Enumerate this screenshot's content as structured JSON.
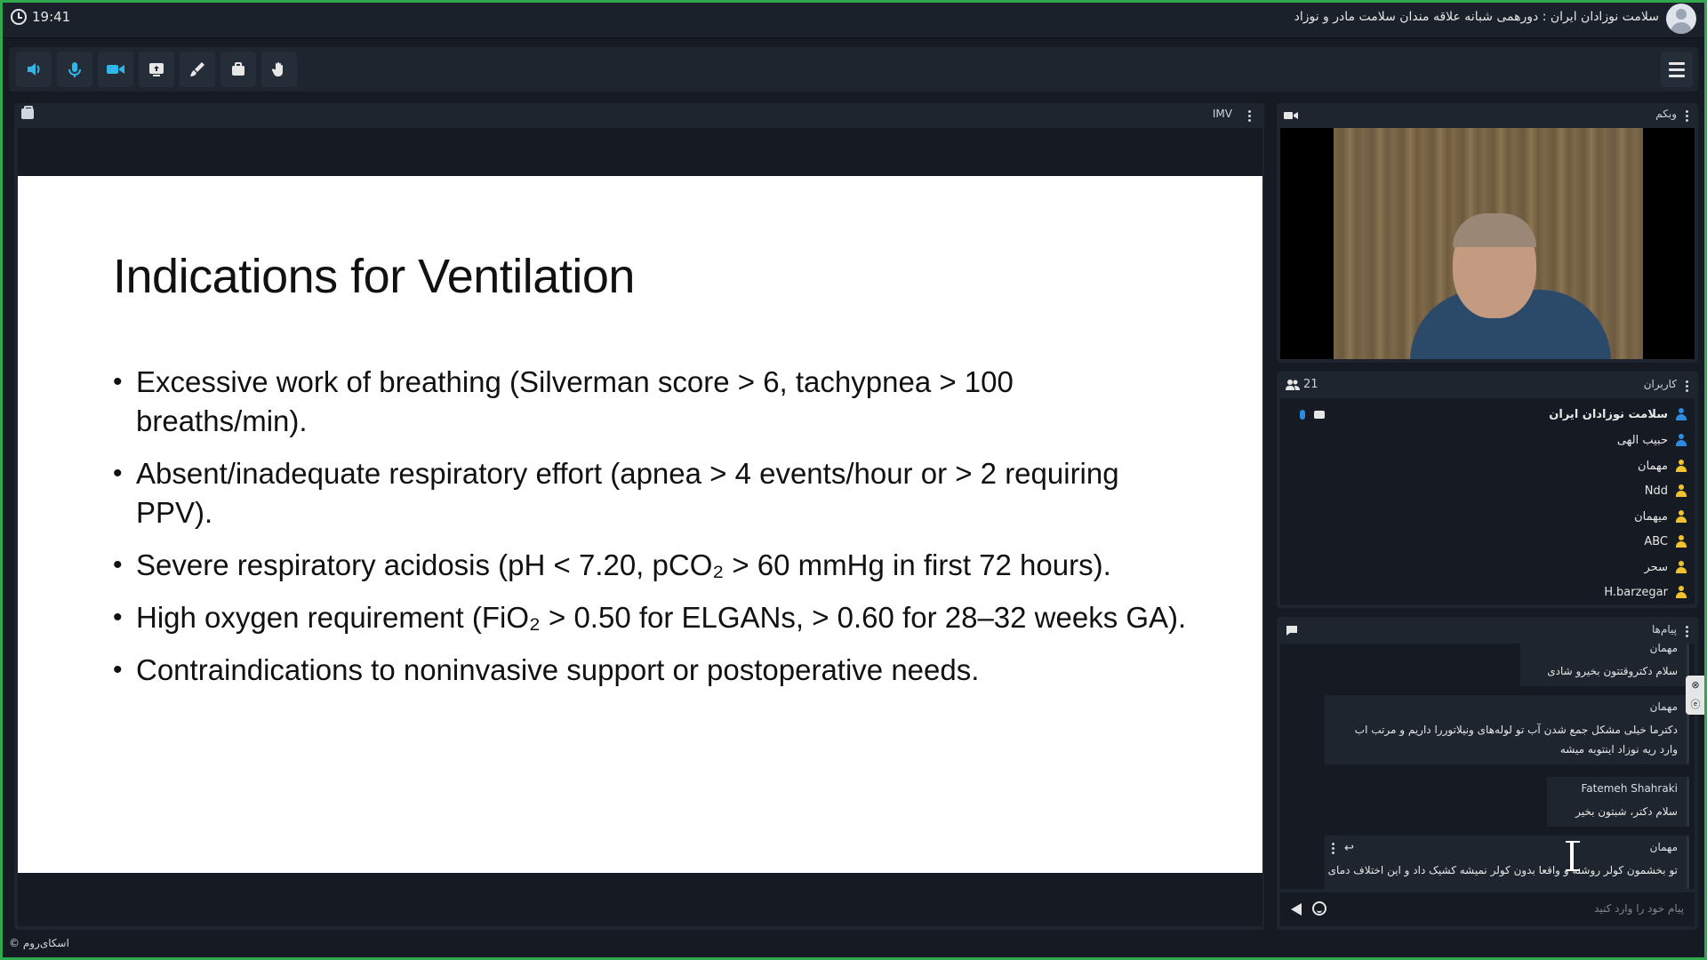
{
  "topbar": {
    "time": "19:41",
    "room_title": "سلامت نوزادان ایران : دورهمی شبانه علاقه مندان سلامت مادر و نوزاد"
  },
  "toolbar": {
    "buttons": [
      "speaker",
      "microphone",
      "camera",
      "share-screen",
      "whiteboard",
      "files",
      "raise-hand"
    ]
  },
  "presentation": {
    "label": "IMV",
    "slide": {
      "title": "Indications for Ventilation",
      "bullets": [
        "Excessive work of breathing (Silverman score > 6, tachypnea > 100 breaths/min).",
        "Absent/inadequate respiratory effort (apnea > 4 events/hour or > 2 requiring PPV).",
        "Severe respiratory acidosis (pH < 7.20, pCO₂ > 60 mmHg in first 72 hours).",
        "High oxygen requirement (FiO₂ > 0.50 for ELGANs, > 0.60 for 28–32 weeks GA).",
        "Contraindications to noninvasive support or postoperative needs."
      ]
    }
  },
  "webcam": {
    "label": "وبکم"
  },
  "users": {
    "label": "کاربران",
    "count": "21",
    "list": [
      {
        "name": "سلامت نوزادان ایران",
        "color": "#2b8be0"
      },
      {
        "name": "حبیب الهی",
        "color": "#2b8be0"
      },
      {
        "name": "مهمان",
        "color": "#f2c12e"
      },
      {
        "name": "Ndd",
        "color": "#f2c12e"
      },
      {
        "name": "میهمان",
        "color": "#f2c12e"
      },
      {
        "name": "ABC",
        "color": "#f2c12e"
      },
      {
        "name": "سحر",
        "color": "#f2c12e"
      },
      {
        "name": "H.barzegar",
        "color": "#f2c12e"
      }
    ]
  },
  "chat": {
    "label": "پیام‌ها",
    "messages": [
      {
        "sender": "مهمان",
        "text": "سلام دکتروقتتون بخیرو شادی"
      },
      {
        "sender": "مهمان",
        "text": "دکترما خیلی مشکل جمع شدن آب تو لوله‌های ونیلاتوررا داریم و مرتب اب وارد ریه نوزاد اینتوبه میشه"
      },
      {
        "sender": "Fatemeh Shahraki",
        "text": "سلام دکتر، شبتون بخیر"
      },
      {
        "sender": "مهمان",
        "text": "تو بخشمون کولر روشنه و واقعا بدون کولر نمیشه کشیک داد و این اختلاف دمای"
      }
    ],
    "input_placeholder": "پیام خود را وارد کنید"
  },
  "footer": {
    "brand": "اسکای‌روم ©"
  },
  "colors": {
    "accent_green": "#2fa84f",
    "icon_blue": "#2b8be0",
    "guest_yellow": "#f2c12e"
  }
}
